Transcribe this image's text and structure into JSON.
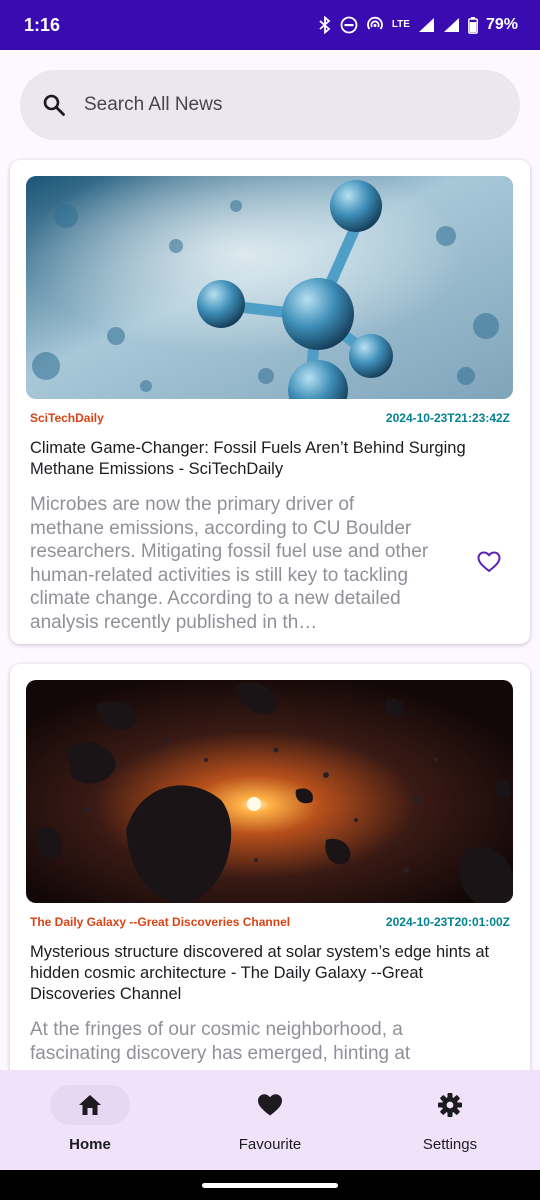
{
  "status_bar": {
    "time": "1:16",
    "network": "LTE",
    "battery": "79%",
    "background": "#3a0bb0"
  },
  "search": {
    "placeholder": "Search All News",
    "value": ""
  },
  "articles": [
    {
      "source": "SciTechDaily",
      "date": "2024-10-23T21:23:42Z",
      "title": "Climate Game-Changer: Fossil Fuels Aren’t Behind Surging Methane Emissions - SciTechDaily",
      "description": "Microbes are now the primary driver of methane emissions, according to CU Boulder researchers. Mitigating fossil fuel use and other human-related activities is still key to tackling climate change. According to a new detailed analysis recently published in th…",
      "favorite_icon": "heart-outline-icon"
    },
    {
      "source": "The Daily Galaxy --Great Discoveries Channel",
      "date": "2024-10-23T20:01:00Z",
      "title": "Mysterious structure discovered at solar system’s edge hints at hidden cosmic architecture - The Daily Galaxy --Great Discoveries Channel",
      "description": "At the fringes of our cosmic neighborhood, a fascinating discovery has emerged, hinting at"
    }
  ],
  "nav": {
    "items": [
      {
        "label": "Home",
        "icon": "home-icon",
        "active": true
      },
      {
        "label": "Favourite",
        "icon": "heart-icon",
        "active": false
      },
      {
        "label": "Settings",
        "icon": "gear-icon",
        "active": false
      }
    ]
  },
  "colors": {
    "accent": "#5b21b6",
    "source": "#d84315",
    "date": "#00838f",
    "nav_background": "#f0e3f9"
  }
}
